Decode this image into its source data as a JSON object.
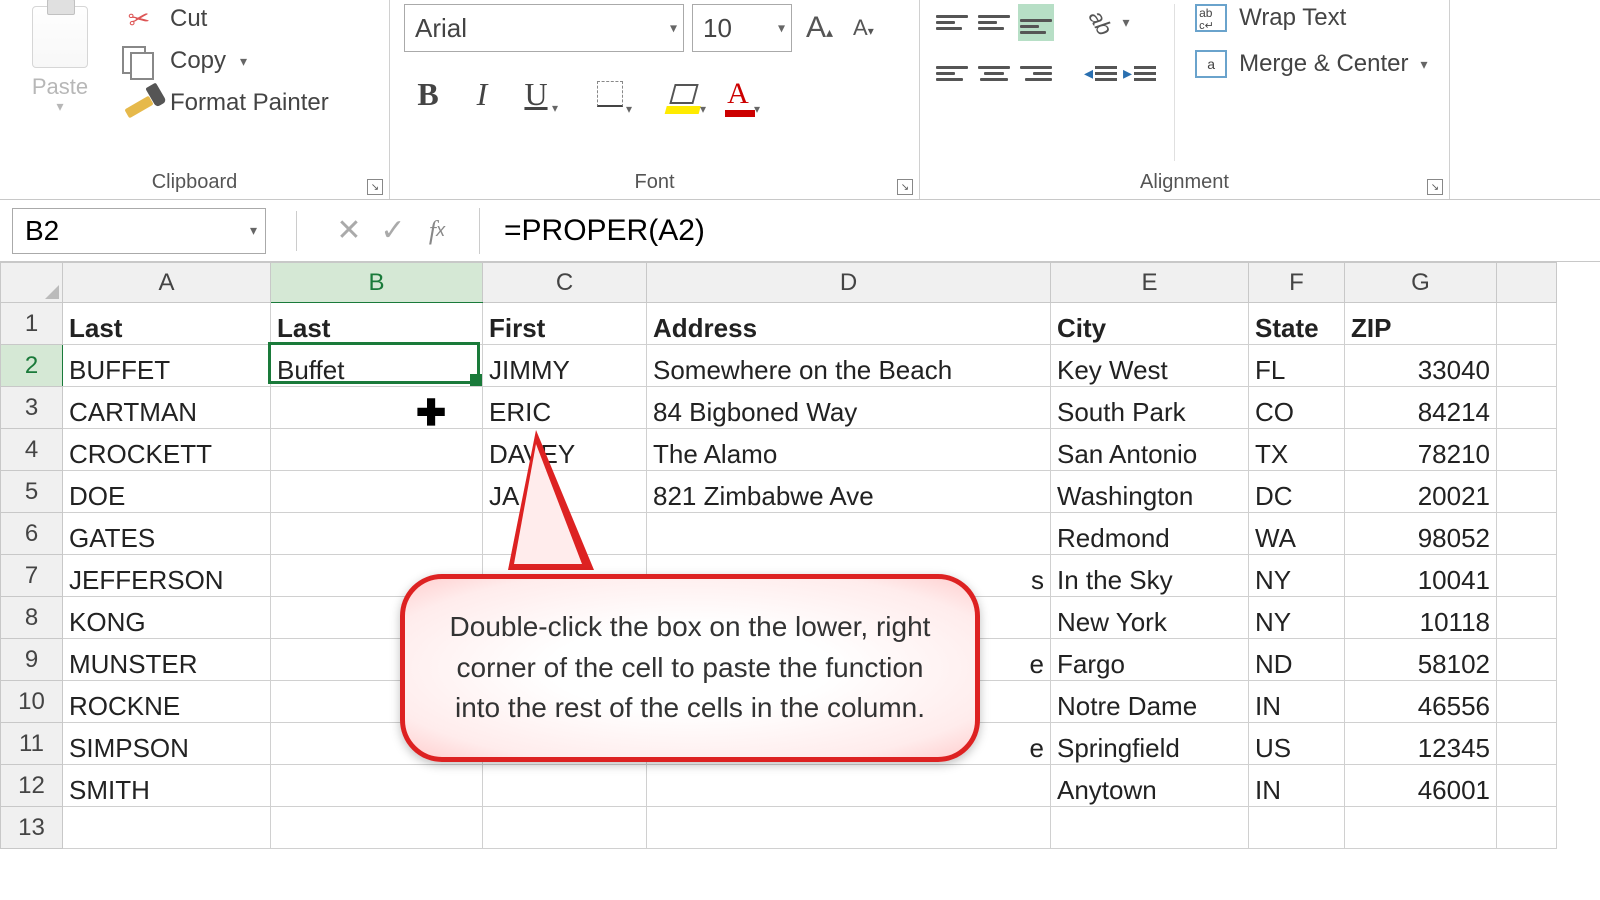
{
  "ribbon": {
    "clipboard": {
      "label": "Clipboard",
      "paste": "Paste",
      "cut": "Cut",
      "copy": "Copy",
      "format_painter": "Format Painter"
    },
    "font": {
      "label": "Font",
      "font_name": "Arial",
      "font_size": "10",
      "bold": "B",
      "italic": "I",
      "underline": "U",
      "grow_font": "A",
      "shrink_font": "A",
      "font_color_letter": "A"
    },
    "alignment": {
      "label": "Alignment",
      "wrap_text": "Wrap Text",
      "merge_center": "Merge & Center",
      "merge_letter": "a"
    }
  },
  "formula_bar": {
    "name_box": "B2",
    "fx": "fx",
    "formula": "=PROPER(A2)"
  },
  "columns": [
    "A",
    "B",
    "C",
    "D",
    "E",
    "F",
    "G"
  ],
  "selected_col": "B",
  "selected_row": 2,
  "headers": {
    "A": "Last",
    "B": "Last",
    "C": "First",
    "D": "Address",
    "E": "City",
    "F": "State",
    "G": "ZIP"
  },
  "rows": [
    {
      "n": 2,
      "A": "BUFFET",
      "B": "Buffet",
      "C": "JIMMY",
      "D": "Somewhere on the Beach",
      "E": "Key West",
      "F": "FL",
      "G": "33040"
    },
    {
      "n": 3,
      "A": "CARTMAN",
      "B": "",
      "C": "ERIC",
      "D": "84 Bigboned Way",
      "E": "South Park",
      "F": "CO",
      "G": "84214"
    },
    {
      "n": 4,
      "A": "CROCKETT",
      "B": "",
      "C": "DAVEY",
      "D": "The Alamo",
      "E": "San Antonio",
      "F": "TX",
      "G": "78210"
    },
    {
      "n": 5,
      "A": "DOE",
      "B": "",
      "C": "JA",
      "D": "821 Zimbabwe Ave",
      "E": "Washington",
      "F": "DC",
      "G": "20021"
    },
    {
      "n": 6,
      "A": "GATES",
      "B": "",
      "C": "",
      "D": "",
      "E": "Redmond",
      "F": "WA",
      "G": "98052"
    },
    {
      "n": 7,
      "A": "JEFFERSON",
      "B": "",
      "C": "",
      "D": "s",
      "E": "In the Sky",
      "F": "NY",
      "G": "10041"
    },
    {
      "n": 8,
      "A": "KONG",
      "B": "",
      "C": "",
      "D": "",
      "E": "New York",
      "F": "NY",
      "G": "10118"
    },
    {
      "n": 9,
      "A": "MUNSTER",
      "B": "",
      "C": "",
      "D": "e",
      "E": "Fargo",
      "F": "ND",
      "G": "58102"
    },
    {
      "n": 10,
      "A": "ROCKNE",
      "B": "",
      "C": "",
      "D": "",
      "E": "Notre Dame",
      "F": "IN",
      "G": "46556"
    },
    {
      "n": 11,
      "A": "SIMPSON",
      "B": "",
      "C": "",
      "D": "e",
      "E": "Springfield",
      "F": "US",
      "G": "12345"
    },
    {
      "n": 12,
      "A": "SMITH",
      "B": "",
      "C": "",
      "D": "",
      "E": "Anytown",
      "F": "IN",
      "G": "46001"
    }
  ],
  "row_tail": 13,
  "callout": "Double-click the box on the lower, right corner of the cell to paste the function into the rest of the cells in the column."
}
